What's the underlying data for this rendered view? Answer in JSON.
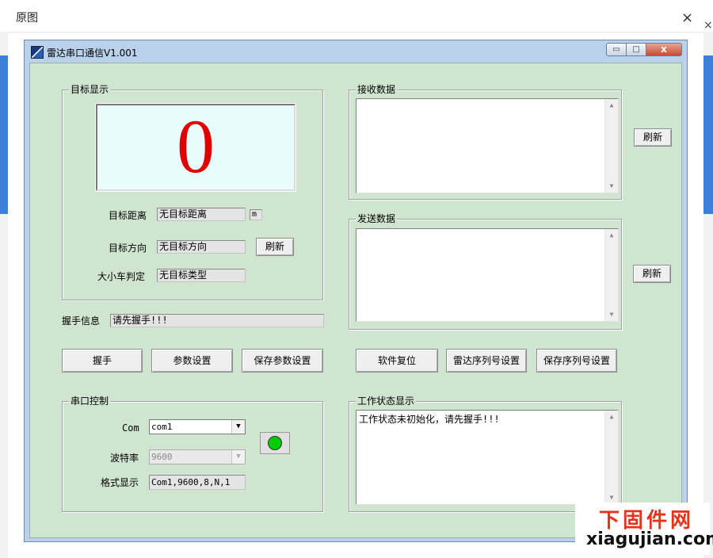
{
  "viewer": {
    "title": "原图",
    "close_glyph": "×",
    "bg_close_glyph": "×"
  },
  "app": {
    "title": "雷达串口通信V1.001",
    "caption_buttons": {
      "minimize": "▭",
      "maximize": "□",
      "close": "x"
    }
  },
  "target_group": {
    "title": "目标显示",
    "big_value": "0",
    "distance": {
      "label": "目标距离",
      "value": "无目标距离",
      "unit": "m"
    },
    "direction": {
      "label": "目标方向",
      "value": "无目标方向"
    },
    "vehicle": {
      "label": "大小车判定",
      "value": "无目标类型"
    },
    "refresh_label": "刷新"
  },
  "handshake": {
    "label": "握手信息",
    "value": "请先握手!!!"
  },
  "left_buttons": {
    "handshake": "握手",
    "params": "参数设置",
    "save_params": "保存参数设置"
  },
  "serial_group": {
    "title": "串口控制",
    "com": {
      "label": "Com",
      "value": "com1"
    },
    "baud": {
      "label": "波特率",
      "value": "9600"
    },
    "format": {
      "label": "格式显示",
      "value": "Com1,9600,8,N,1"
    },
    "indicator_color": "#00cc00"
  },
  "receive_group": {
    "title": "接收数据",
    "content": "",
    "refresh_label": "刷新"
  },
  "send_group": {
    "title": "发送数据",
    "content": "",
    "refresh_label": "刷新"
  },
  "right_buttons": {
    "reset": "软件复位",
    "serial_no": "雷达序列号设置",
    "save_serial_no": "保存序列号设置"
  },
  "status_group": {
    "title": "工作状态显示",
    "content": "工作状态未初始化，请先握手!!!"
  },
  "watermark": {
    "cn": "下固件网",
    "en": "xiagujian.com"
  },
  "colors": {
    "client_bg": "#d0e5cf",
    "big_value": "#e00000",
    "display_bg": "#e8fcfc"
  }
}
